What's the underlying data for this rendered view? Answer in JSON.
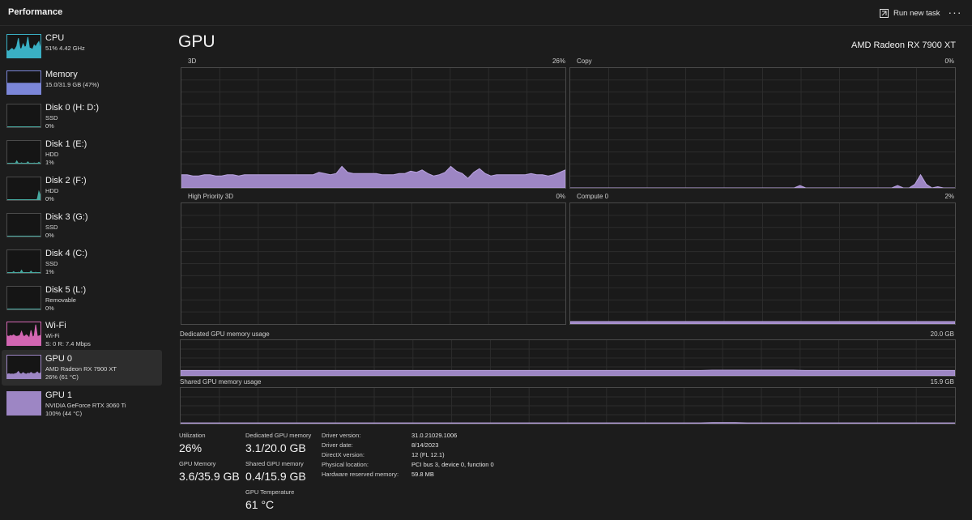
{
  "window": {
    "title": "Performance",
    "run_new_task": "Run new task"
  },
  "colors": {
    "cpu": "#3ab0c4",
    "memory": "#7b86d8",
    "disk": "#47a9a0",
    "wifi": "#d266b2",
    "gpu": "#9d86c4",
    "background": "#1c1c1c"
  },
  "sidebar": {
    "items": [
      {
        "name": "CPU",
        "line1": "51% 4.42 GHz",
        "line2": "",
        "icon": "cpu-graph-thumbnail"
      },
      {
        "name": "Memory",
        "line1": "15.0/31.9 GB (47%)",
        "line2": "",
        "icon": "memory-graph-thumbnail"
      },
      {
        "name": "Disk 0 (H: D:)",
        "line1": "SSD",
        "line2": "0%",
        "icon": "disk-graph-thumbnail"
      },
      {
        "name": "Disk 1 (E:)",
        "line1": "HDD",
        "line2": "1%",
        "icon": "disk-graph-thumbnail"
      },
      {
        "name": "Disk 2 (F:)",
        "line1": "HDD",
        "line2": "0%",
        "icon": "disk-graph-thumbnail"
      },
      {
        "name": "Disk 3 (G:)",
        "line1": "SSD",
        "line2": "0%",
        "icon": "disk-graph-thumbnail"
      },
      {
        "name": "Disk 4 (C:)",
        "line1": "SSD",
        "line2": "1%",
        "icon": "disk-graph-thumbnail"
      },
      {
        "name": "Disk 5 (L:)",
        "line1": "Removable",
        "line2": "0%",
        "icon": "disk-graph-thumbnail"
      },
      {
        "name": "Wi-Fi",
        "line1": "Wi-Fi",
        "line2": "S: 0 R: 7.4 Mbps",
        "icon": "wifi-graph-thumbnail"
      },
      {
        "name": "GPU 0",
        "line1": "AMD Radeon RX 7900 XT",
        "line2": "26% (61 °C)",
        "icon": "gpu-graph-thumbnail",
        "selected": true
      },
      {
        "name": "GPU 1",
        "line1": "NVIDIA GeForce RTX 3060 Ti",
        "line2": "100% (44 °C)",
        "icon": "gpu-graph-thumbnail"
      }
    ]
  },
  "main": {
    "title": "GPU",
    "device": "AMD Radeon RX 7900 XT",
    "graphs": {
      "g3d": {
        "label": "3D",
        "value": "26%"
      },
      "copy": {
        "label": "Copy",
        "value": "0%"
      },
      "hp3d": {
        "label": "High Priority 3D",
        "value": "0%"
      },
      "compute": {
        "label": "Compute 0",
        "value": "2%"
      },
      "dedicated": {
        "label": "Dedicated GPU memory usage",
        "value": "20.0 GB"
      },
      "shared": {
        "label": "Shared GPU memory usage",
        "value": "15.9 GB"
      }
    },
    "stats": {
      "utilization_label": "Utilization",
      "utilization": "26%",
      "gpu_memory_label": "GPU Memory",
      "gpu_memory": "3.6/35.9 GB",
      "dedicated_label": "Dedicated GPU memory",
      "dedicated": "3.1/20.0 GB",
      "shared_label": "Shared GPU memory",
      "shared": "0.4/15.9 GB",
      "temp_label": "GPU Temperature",
      "temp": "61 °C"
    },
    "info": [
      {
        "k": "Driver version:",
        "v": "31.0.21029.1006"
      },
      {
        "k": "Driver date:",
        "v": "8/14/2023"
      },
      {
        "k": "DirectX version:",
        "v": "12 (FL 12.1)"
      },
      {
        "k": "Physical location:",
        "v": "PCI bus 3, device 0, function 0"
      },
      {
        "k": "Hardware reserved memory:",
        "v": "59.8 MB"
      }
    ]
  },
  "series": {
    "gpu3d": [
      11,
      11,
      10,
      10,
      11,
      11,
      10,
      10,
      11,
      11,
      10,
      11,
      11,
      11,
      11,
      11,
      11,
      11,
      11,
      11,
      11,
      11,
      11,
      11,
      13,
      12,
      11,
      12,
      18,
      13,
      12,
      12,
      12,
      12,
      12,
      11,
      11,
      11,
      12,
      12,
      14,
      13,
      15,
      12,
      10,
      11,
      13,
      18,
      14,
      12,
      8,
      13,
      16,
      12,
      10,
      11,
      11,
      11,
      11,
      11,
      11,
      12,
      11,
      11,
      10,
      11,
      13,
      15
    ],
    "copy": [
      0,
      0,
      0,
      0,
      0,
      0,
      0,
      0,
      0,
      0,
      0,
      0,
      0,
      0,
      0,
      0,
      0,
      0,
      0,
      0,
      0,
      0,
      0,
      0,
      0,
      0,
      0,
      0,
      0,
      0,
      0,
      0,
      0,
      0,
      0,
      0,
      0,
      0,
      0,
      0,
      2,
      0,
      0,
      0,
      0,
      0,
      0,
      0,
      0,
      0,
      0,
      0,
      0,
      0,
      0,
      0,
      0,
      2,
      0,
      0,
      3,
      11,
      3,
      0,
      1,
      0,
      0,
      0
    ],
    "compute": [
      2,
      2,
      2,
      2,
      2,
      2,
      2,
      2,
      2,
      2,
      2,
      2,
      2,
      2,
      2,
      2,
      2,
      2,
      2,
      2,
      2,
      2,
      2,
      2,
      2,
      2,
      2,
      2,
      2,
      2,
      2,
      2,
      2,
      2,
      2,
      2,
      2,
      2,
      2,
      2,
      2,
      2,
      2,
      2,
      2,
      2,
      2,
      2,
      2,
      2,
      2,
      2,
      2,
      2,
      2,
      2,
      2,
      2,
      2,
      2,
      2,
      2,
      2,
      2,
      2,
      2,
      2,
      2
    ],
    "dedicated": [
      15,
      15,
      15,
      15,
      15,
      15,
      15,
      15,
      15,
      15,
      15,
      15,
      15,
      15,
      15,
      15,
      15,
      15,
      15,
      15,
      15,
      15,
      15,
      15,
      15,
      15,
      15,
      15,
      15,
      15,
      15,
      15,
      15,
      15,
      15,
      15,
      15,
      15,
      15,
      15,
      15,
      15,
      15,
      15,
      15,
      15,
      16,
      16,
      16,
      16,
      16,
      16,
      16,
      16,
      15,
      15,
      15,
      15,
      15,
      15,
      15,
      15,
      15,
      15,
      15,
      15,
      15,
      15
    ],
    "shared": [
      2,
      2,
      2,
      2,
      2,
      2,
      2,
      2,
      2,
      2,
      2,
      2,
      2,
      2,
      2,
      2,
      2,
      2,
      2,
      2,
      2,
      2,
      2,
      2,
      2,
      2,
      2,
      2,
      2,
      2,
      2,
      2,
      2,
      2,
      2,
      2,
      2,
      2,
      2,
      2,
      2,
      2,
      2,
      2,
      2,
      2,
      3,
      3,
      3,
      2,
      2,
      2,
      2,
      2,
      2,
      2,
      2,
      2,
      2,
      2,
      2,
      2,
      2,
      2,
      2,
      2,
      2,
      2
    ],
    "thumb_cpu": [
      30,
      28,
      35,
      40,
      32,
      38,
      50,
      85,
      40,
      38,
      60,
      45,
      50,
      90,
      42,
      40,
      35,
      55,
      48,
      60,
      70,
      40
    ],
    "thumb_memory": [
      47,
      47,
      47,
      47,
      47,
      47,
      47,
      47,
      47,
      47,
      47,
      47,
      47,
      47,
      47,
      47,
      47,
      47,
      47,
      47,
      47,
      47
    ],
    "thumb_wifi": [
      40,
      38,
      42,
      40,
      45,
      40,
      38,
      40,
      42,
      60,
      40,
      38,
      45,
      40,
      30,
      65,
      35,
      40,
      90,
      38,
      40,
      42
    ],
    "thumb_gpu0": [
      18,
      20,
      18,
      19,
      18,
      20,
      22,
      30,
      20,
      19,
      25,
      20,
      18,
      22,
      20,
      26,
      21,
      20,
      22,
      28,
      20,
      24
    ],
    "thumb_gpu1": [
      100,
      100,
      100,
      100,
      100,
      100,
      100,
      100,
      100,
      100,
      100,
      100,
      100,
      100,
      100,
      100,
      100,
      100,
      100,
      100,
      100,
      100
    ],
    "thumb_disk0": [
      0,
      0,
      0,
      0,
      0,
      0,
      0,
      0,
      0,
      0,
      0,
      0,
      0,
      0,
      0,
      0,
      0,
      0,
      0,
      0,
      0,
      0
    ],
    "thumb_disk1": [
      0,
      0,
      0,
      2,
      0,
      0,
      12,
      0,
      0,
      4,
      0,
      0,
      0,
      8,
      0,
      0,
      0,
      3,
      0,
      0,
      6,
      0
    ],
    "thumb_disk2": [
      0,
      0,
      0,
      0,
      0,
      0,
      0,
      0,
      0,
      0,
      0,
      0,
      0,
      0,
      0,
      0,
      0,
      0,
      0,
      5,
      38,
      20
    ],
    "thumb_disk3": [
      0,
      0,
      0,
      0,
      0,
      0,
      0,
      0,
      0,
      0,
      0,
      0,
      0,
      0,
      0,
      0,
      0,
      0,
      0,
      0,
      0,
      0
    ],
    "thumb_disk4": [
      0,
      2,
      0,
      0,
      6,
      0,
      0,
      3,
      0,
      12,
      0,
      0,
      2,
      0,
      0,
      8,
      0,
      0,
      3,
      0,
      0,
      2
    ],
    "thumb_disk5": [
      0,
      0,
      0,
      0,
      0,
      0,
      0,
      0,
      0,
      0,
      0,
      0,
      0,
      0,
      0,
      0,
      0,
      0,
      0,
      0,
      0,
      0
    ]
  }
}
